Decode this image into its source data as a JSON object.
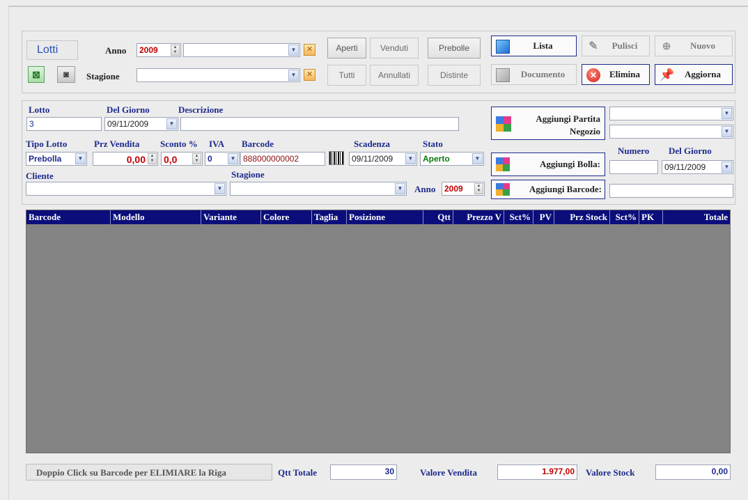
{
  "filters": {
    "title": "Lotti",
    "anno_label": "Anno",
    "anno_value": "2009",
    "anno_combo_value": "",
    "stagione_label": "Stagione",
    "stagione_value": "",
    "status_buttons": [
      "Aperti",
      "Venduti",
      "Prebolle",
      "Tutti",
      "Annullati",
      "Distinte"
    ]
  },
  "actions": {
    "lista": "Lista",
    "pulisci": "Pulisci",
    "nuovo": "Nuovo",
    "documento": "Documento",
    "elimina": "Elimina",
    "aggiorna": "Aggiorna"
  },
  "form": {
    "lotto_label": "Lotto",
    "lotto_value": "3",
    "del_giorno_label": "Del Giorno",
    "del_giorno_value": "09/11/2009",
    "descrizione_label": "Descrizione",
    "descrizione_value": "",
    "tipo_lotto_label": "Tipo Lotto",
    "tipo_lotto_value": "Prebolla",
    "prz_vendita_label": "Prz Vendita",
    "prz_vendita_value": "0,00",
    "sconto_label": "Sconto %",
    "sconto_value": "0,0",
    "iva_label": "IVA",
    "iva_value": "0",
    "barcode_label": "Barcode",
    "barcode_value": "888000000002",
    "scadenza_label": "Scadenza",
    "scadenza_value": "09/11/2009",
    "stato_label": "Stato",
    "stato_value": "Aperto",
    "cliente_label": "Cliente",
    "cliente_value": "",
    "stagione_label": "Stagione",
    "stagione_value": "",
    "anno_label": "Anno",
    "anno_value": "2009"
  },
  "side": {
    "aggiungi_partita": "Aggiungi Partita Negozio",
    "aggiungi_bolla": "Aggiungi Bolla:",
    "aggiungi_barcode": "Aggiungi Barcode:",
    "numero_label": "Numero",
    "del_giorno_label": "Del Giorno",
    "del_giorno_value": "09/11/2009",
    "numero_value": "",
    "barcode_input": ""
  },
  "grid": {
    "columns": [
      "Barcode",
      "Modello",
      "Variante",
      "Colore",
      "Taglia",
      "Posizione",
      "Qtt",
      "Prezzo V",
      "Sct%",
      "PV",
      "Prz Stock",
      "Sct%",
      "PK",
      "Totale"
    ]
  },
  "footer": {
    "hint": "Doppio Click su Barcode per ELIMIARE la Riga",
    "qtt_totale_label": "Qtt Totale",
    "qtt_totale_value": "30",
    "valore_vendita_label": "Valore Vendita",
    "valore_vendita_value": "1.977,00",
    "valore_stock_label": "Valore Stock",
    "valore_stock_value": "0,00"
  },
  "colors": {
    "header_bg": "#0b0e7a",
    "label_blue": "#1d2a8c",
    "value_red": "#c00000",
    "grid_bg": "#848484"
  }
}
